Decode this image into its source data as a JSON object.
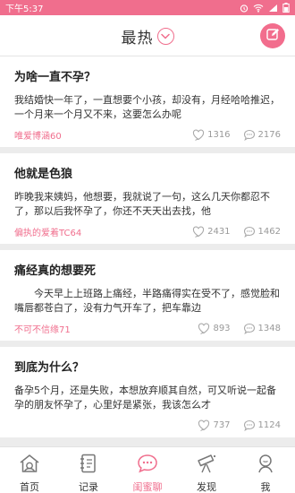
{
  "status": {
    "time": "下午5:37"
  },
  "header": {
    "title": "最热"
  },
  "posts": [
    {
      "title": "为啥一直不孕？",
      "body": "我结婚快一年了，一直想要个小孩，却没有，月经哈哈推迟，一个月来一个月又不来，这要怎么办呢",
      "author": "唯爱博涵60",
      "likes": "1316",
      "comments": "2176",
      "indent": false
    },
    {
      "title": "他就是色狼",
      "body": "昨晚我来姨妈，他想要，我就说了一句，这么几天你都忍不了，那以后我怀孕了，你还不天天出去找，他",
      "author": "偏执的爱着TC64",
      "likes": "2431",
      "comments": "1462",
      "indent": false
    },
    {
      "title": "痛经真的想要死",
      "body": "今天早上上班路上痛经，半路痛得实在受不了，感觉脸和嘴唇都苍白了，没有力气开车了，把车靠边",
      "author": "不可不信缘71",
      "likes": "893",
      "comments": "1348",
      "indent": true
    },
    {
      "title": "到底为什么？",
      "body": "备孕5个月，还是失败，本想放弃顺其自然，可又听说一起备孕的朋友怀孕了，心里好是紧张，我该怎么才",
      "author": "",
      "likes": "737",
      "comments": "1124",
      "indent": false
    }
  ],
  "tabs": [
    {
      "label": "首页",
      "icon": "home-icon"
    },
    {
      "label": "记录",
      "icon": "notebook-icon"
    },
    {
      "label": "闺蜜聊",
      "icon": "chat-bubble-icon"
    },
    {
      "label": "发现",
      "icon": "telescope-icon"
    },
    {
      "label": "我",
      "icon": "profile-icon"
    }
  ],
  "colors": {
    "accent": "#f06e8d",
    "status_bar": "#f06e8d",
    "meta_gray": "#999999"
  }
}
